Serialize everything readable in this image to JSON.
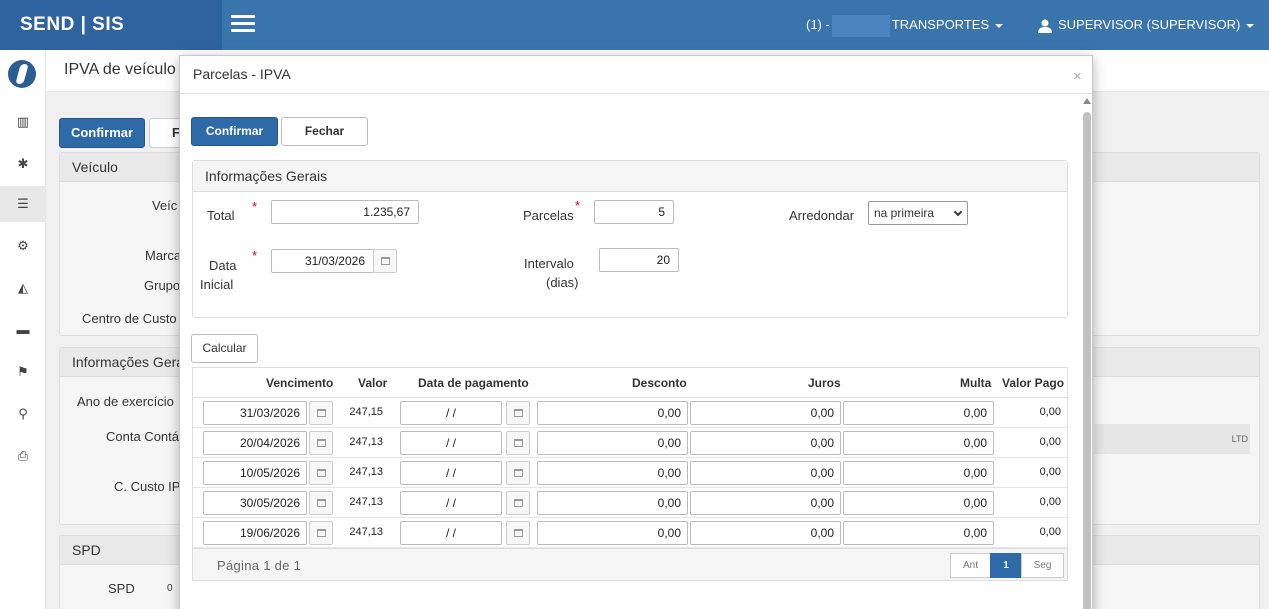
{
  "topbar": {
    "brand": "SEND | SIS",
    "company_prefix": "(1) -",
    "company_name": "TRANSPORTES",
    "user": "SUPERVISOR (SUPERVISOR)"
  },
  "sidebar": {
    "items": [
      {
        "name": "chart-icon",
        "glyph": "▥"
      },
      {
        "name": "gear-icon",
        "glyph": "✱"
      },
      {
        "name": "list-icon",
        "glyph": "☰"
      },
      {
        "name": "gears-icon",
        "glyph": "⚙"
      },
      {
        "name": "area-chart-icon",
        "glyph": "◭"
      },
      {
        "name": "truck-icon",
        "glyph": "▬"
      },
      {
        "name": "flag-icon",
        "glyph": "⚑"
      },
      {
        "name": "search-icon",
        "glyph": "⚲"
      },
      {
        "name": "print-icon",
        "glyph": "⎙"
      }
    ]
  },
  "background": {
    "page_title": "IPVA de veículo",
    "confirm_label": "Confirmar",
    "second_button_label": "F",
    "panel_veiculo": "Veículo",
    "panel_info": "Informações Gera",
    "panel_spd": "SPD",
    "labels": {
      "veic": "Veíc",
      "marca": "Marca",
      "grupo": "Grupo",
      "centro": "Centro de Custo",
      "ano": "Ano de exercício",
      "conta": "Conta Contá",
      "ccusto": "C. Custo IP",
      "spd": "SPD",
      "spd_val": "0"
    },
    "ltd": "LTD"
  },
  "modal": {
    "title": "Parcelas - IPVA",
    "close": "×",
    "confirm_label": "Confirmar",
    "close_label": "Fechar",
    "panel_title": "Informações Gerais",
    "total_label": "Total",
    "total_value": "1.235,67",
    "parcelas_label": "Parcelas",
    "parcelas_value": "5",
    "arredondar_label": "Arredondar",
    "arredondar_value": "na primeira",
    "data_inicial_label_1": "Data",
    "data_inicial_label_2": "Inicial",
    "data_inicial_value": "31/03/2026",
    "intervalo_label_1": "Intervalo",
    "intervalo_label_2": "(dias)",
    "intervalo_value": "20",
    "calc_label": "Calcular",
    "columns": {
      "vencimento": "Vencimento",
      "valor": "Valor",
      "data_pagamento": "Data de pagamento",
      "desconto": "Desconto",
      "juros": "Juros",
      "multa": "Multa",
      "valor_pago": "Valor Pago"
    },
    "rows": [
      {
        "vencimento": "31/03/2026",
        "valor": "247,15",
        "data_pagamento": " /  /",
        "desconto": "0,00",
        "juros": "0,00",
        "multa": "0,00",
        "valor_pago": "0,00"
      },
      {
        "vencimento": "20/04/2026",
        "valor": "247,13",
        "data_pagamento": " /  /",
        "desconto": "0,00",
        "juros": "0,00",
        "multa": "0,00",
        "valor_pago": "0,00"
      },
      {
        "vencimento": "10/05/2026",
        "valor": "247,13",
        "data_pagamento": " /  /",
        "desconto": "0,00",
        "juros": "0,00",
        "multa": "0,00",
        "valor_pago": "0,00"
      },
      {
        "vencimento": "30/05/2026",
        "valor": "247,13",
        "data_pagamento": " /  /",
        "desconto": "0,00",
        "juros": "0,00",
        "multa": "0,00",
        "valor_pago": "0,00"
      },
      {
        "vencimento": "19/06/2026",
        "valor": "247,13",
        "data_pagamento": " /  /",
        "desconto": "0,00",
        "juros": "0,00",
        "multa": "0,00",
        "valor_pago": "0,00"
      }
    ],
    "pagination": {
      "info": "Página 1 de 1",
      "prev": "Ant",
      "current": "1",
      "next": "Seg"
    }
  },
  "colors": {
    "topbar": "#3a74ad",
    "brand": "#2f63a0",
    "primary": "#2f6aa8",
    "required": "#dd0000"
  }
}
